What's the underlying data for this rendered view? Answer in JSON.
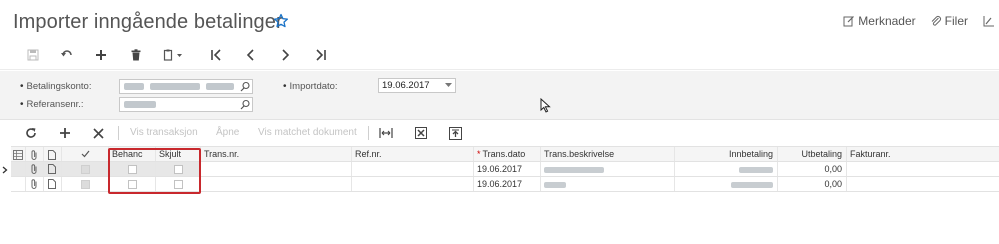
{
  "title": "Importer inngående betalinger",
  "top_actions": {
    "notes": "Merknader",
    "files": "Filer"
  },
  "form": {
    "account_label": "Betalingskonto:",
    "reference_label": "Referansenr.:",
    "import_date_label": "Importdato:",
    "import_date_value": "19.06.2017"
  },
  "grid_toolbar": {
    "view_transaction": "Vis transaksjon",
    "open": "Åpne",
    "view_matched": "Vis matchet dokument"
  },
  "columns": {
    "processed": "Behanc",
    "hidden": "Skjult",
    "trans_no": "Trans.nr.",
    "ref_no": "Ref.nr.",
    "trans_date": "Trans.dato",
    "trans_desc": "Trans.beskrivelse",
    "deposit": "Innbetaling",
    "payment": "Utbetaling",
    "invoice_no": "Fakturanr."
  },
  "rows": [
    {
      "trans_date": "19.06.2017",
      "payment": "0,00"
    },
    {
      "trans_date": "19.06.2017",
      "payment": "0,00"
    }
  ],
  "colors": {
    "accent": "#1a73c8",
    "highlight": "#c8282d"
  }
}
